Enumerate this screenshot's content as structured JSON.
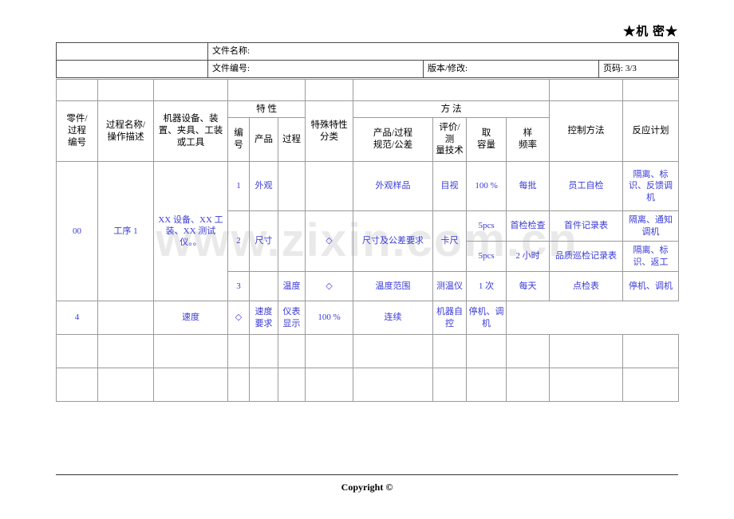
{
  "confidential_mark": "★机 密★",
  "doc_header": {
    "rows": [
      {
        "label": "文件名称:",
        "value": "",
        "right_label": "",
        "right_value": "",
        "page_label": "",
        "page_value": ""
      },
      {
        "label": "文件编号:",
        "value": "",
        "right_label": "版本/修改:",
        "right_value": "",
        "page_label": "页码:",
        "page_value": "3/3"
      }
    ]
  },
  "main_table": {
    "group_headers": {
      "characteristic": "特            性",
      "method": "方                    法",
      "sampling": "取            样"
    },
    "columns": {
      "part_process_no": "零件/\n过程\n编号",
      "process_name": "过程名称/\n操作描述",
      "equipment": "机器设备、装置、夹具、工装或工具",
      "char_no": "编号",
      "char_product": "产品",
      "char_process": "过程",
      "special_class": "特殊特性分类",
      "spec_tolerance": "产品/过程规范/公差",
      "eval_technique": "评价/测量技术",
      "sample_size": "容量",
      "sample_freq": "频率",
      "control_method": "控制方法",
      "reaction_plan": "反应计划"
    },
    "rows": [
      {
        "part_process_no": "00",
        "process_name": "工序 1",
        "equipment": "XX 设备、XX 工装、XX 测试仪。。",
        "char_no": "1",
        "char_product": "外观",
        "char_process": "",
        "special_class": "",
        "spec_tolerance": "外观样品",
        "eval_technique": "目视",
        "sample_size": "100 %",
        "sample_freq": "每批",
        "control_method": "员工自检",
        "reaction_plan": "隔离、标识、反馈调机"
      },
      {
        "char_no": "2",
        "char_product": "尺寸",
        "char_process": "",
        "special_class": "◇",
        "spec_tolerance": "尺寸及公差要求",
        "eval_technique": "卡尺",
        "sample_size": "5pcs",
        "sample_freq": "首检检查",
        "control_method": "首件记录表",
        "reaction_plan": "隔离、通知调机"
      },
      {
        "sample_size": "5pcs",
        "sample_freq": "2 小时",
        "control_method": "品质巡检记录表",
        "reaction_plan": "隔离、标识、返工"
      },
      {
        "char_no": "3",
        "char_product": "",
        "char_process": "温度",
        "special_class": "◇",
        "spec_tolerance": "温度范围",
        "eval_technique": "测温仪",
        "sample_size": "1 次",
        "sample_freq": "每天",
        "control_method": "点检表",
        "reaction_plan": "停机、调机"
      },
      {
        "char_no": "4",
        "char_product": "",
        "char_process": "速度",
        "special_class": "◇",
        "spec_tolerance": "速度要求",
        "eval_technique": "仪表显示",
        "sample_size": "100 %",
        "sample_freq": "连续",
        "control_method": "机器自控",
        "reaction_plan": "停机、调机"
      }
    ],
    "empty_rows": 2
  },
  "watermark": "www.zixin.com.cn",
  "footer": {
    "copyright": "Copyright ©"
  }
}
